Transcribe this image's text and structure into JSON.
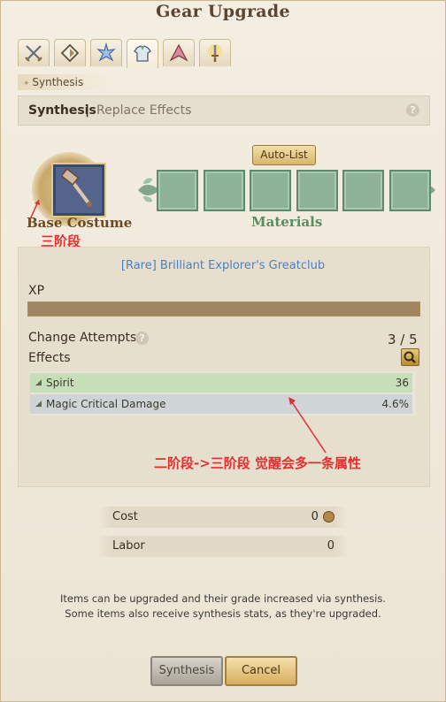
{
  "window": {
    "title": "Gear Upgrade"
  },
  "tabs": [
    {
      "icon": "crossed-swords-icon"
    },
    {
      "icon": "diamond-shield-icon"
    },
    {
      "icon": "star-burst-icon"
    },
    {
      "icon": "armor-icon"
    },
    {
      "icon": "arrowhead-icon"
    },
    {
      "icon": "sword-upgrade-icon"
    }
  ],
  "breadcrumb": {
    "label": "Synthesis"
  },
  "subtabs": {
    "active": "Synthesis",
    "separator": "|",
    "inactive": "Replace Effects",
    "help": "?"
  },
  "base": {
    "label": "Base Costume",
    "annotation": "三阶段"
  },
  "materials": {
    "autolist_label": "Auto-List",
    "label": "Materials",
    "slot_count": 6
  },
  "item": {
    "name": "[Rare] Brilliant Explorer's Greatclub",
    "xp_label": "XP",
    "xp_fill": 1.0,
    "attempts_label": "Change Attempts",
    "attempts_help": "?",
    "attempts_value": "3 / 5",
    "effects_label": "Effects",
    "effects": [
      {
        "name": "Spirit",
        "value": "36"
      },
      {
        "name": "Magic Critical Damage",
        "value": "4.6%"
      }
    ],
    "annotation": "二阶段->三阶段 觉醒会多一条属性"
  },
  "costs": {
    "cost_label": "Cost",
    "cost_value": "0",
    "labor_label": "Labor",
    "labor_value": "0"
  },
  "footnote": {
    "line1": "Items can be upgraded and their grade increased via synthesis.",
    "line2": "Some items also receive synthesis stats, as they're upgraded."
  },
  "buttons": {
    "synthesis": "Synthesis",
    "cancel": "Cancel"
  },
  "colors": {
    "effect_row_1": "#c6dfb8",
    "effect_row_2": "#cfd4d6",
    "annotation": "#e03030",
    "item_name": "#4a7fc0"
  }
}
